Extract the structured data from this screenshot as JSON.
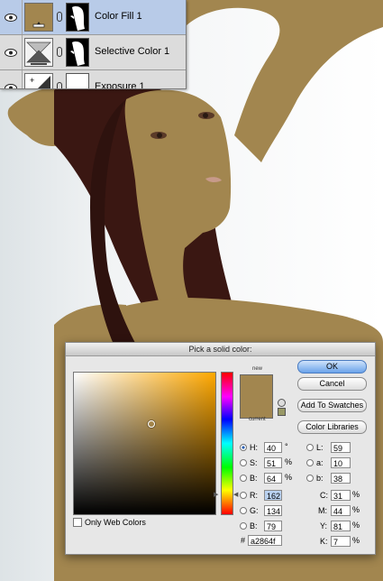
{
  "colors": {
    "fill": "#a2864f",
    "hair": "#3a1712",
    "background": "#e9eef0",
    "selection": "#b8cbe8"
  },
  "layers_panel": {
    "layers": [
      {
        "name": "Color Fill 1",
        "selected": true,
        "thumb_icon": "color-fill-swatch-icon"
      },
      {
        "name": "Selective Color 1",
        "selected": false,
        "thumb_icon": "selective-color-adjustment-icon"
      },
      {
        "name": "Exposure 1",
        "selected": false,
        "thumb_icon": "exposure-adjustment-icon"
      }
    ],
    "eye_icon": "eye-icon"
  },
  "color_picker": {
    "title": "Pick a solid color:",
    "new_label": "new",
    "current_label": "current",
    "buttons": {
      "ok": "OK",
      "cancel": "Cancel",
      "add_to_swatches": "Add To Swatches",
      "color_libraries": "Color Libraries"
    },
    "only_web_colors": "Only Web Colors",
    "hsb": {
      "h": {
        "label": "H:",
        "value": "40",
        "unit": "°",
        "selected": true
      },
      "s": {
        "label": "S:",
        "value": "51",
        "unit": "%"
      },
      "b": {
        "label": "B:",
        "value": "64",
        "unit": "%"
      }
    },
    "rgb": {
      "r": {
        "label": "R:",
        "value": "162"
      },
      "g": {
        "label": "G:",
        "value": "134"
      },
      "b": {
        "label": "B:",
        "value": "79"
      }
    },
    "lab": {
      "l": {
        "label": "L:",
        "value": "59"
      },
      "a": {
        "label": "a:",
        "value": "10"
      },
      "b": {
        "label": "b:",
        "value": "38"
      }
    },
    "cmyk": {
      "c": {
        "label": "C:",
        "value": "31",
        "unit": "%"
      },
      "m": {
        "label": "M:",
        "value": "44",
        "unit": "%"
      },
      "y": {
        "label": "Y:",
        "value": "81",
        "unit": "%"
      },
      "k": {
        "label": "K:",
        "value": "7",
        "unit": "%"
      }
    },
    "hex": {
      "label": "#",
      "value": "a2864f"
    }
  }
}
